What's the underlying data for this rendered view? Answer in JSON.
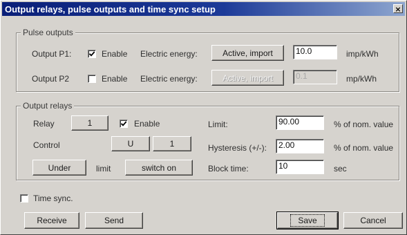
{
  "window": {
    "title": "Output relays, pulse outputs and time sync setup",
    "close_glyph": "×"
  },
  "pulse_outputs": {
    "group_title": "Pulse outputs",
    "p1": {
      "label": "Output P1:",
      "enable_label": "Enable",
      "enabled": true,
      "energy_label": "Electric energy:",
      "mode_button": "Active, import",
      "value": "10.0",
      "unit": "imp/kWh"
    },
    "p2": {
      "label": "Output P2",
      "enable_label": "Enable",
      "enabled": false,
      "energy_label": "Electric energy:",
      "mode_button": "Active, import",
      "value": "0.1",
      "unit": "mp/kWh"
    }
  },
  "output_relays": {
    "group_title": "Output relays",
    "relay_label": "Relay",
    "relay_number": "1",
    "enable_label": "Enable",
    "enabled": true,
    "control_label": "Control",
    "control_quantity": "U",
    "control_phase": "1",
    "condition_button": "Under",
    "limit_text": "limit",
    "action_button": "switch on",
    "limit": {
      "label": "Limit:",
      "value": "90.00",
      "unit": "% of nom. value"
    },
    "hysteresis": {
      "label": "Hysteresis (+/-):",
      "value": "2.00",
      "unit": "% of nom. value"
    },
    "block_time": {
      "label": "Block time:",
      "value": "10",
      "unit": "sec"
    }
  },
  "time_sync": {
    "label": "Time sync.",
    "checked": false
  },
  "buttons": {
    "receive": "Receive",
    "send": "Send",
    "save": "Save",
    "cancel": "Cancel"
  }
}
